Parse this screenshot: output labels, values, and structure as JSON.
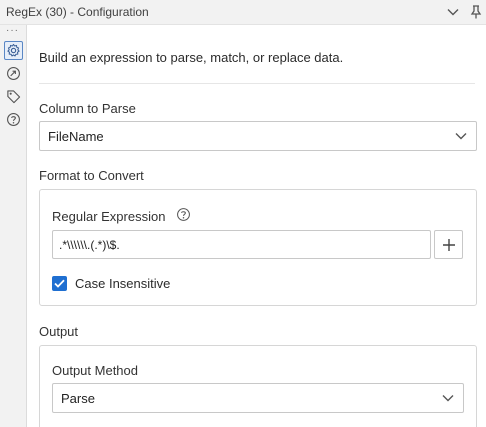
{
  "window": {
    "title": "RegEx (30) - Configuration"
  },
  "rail": {
    "items": [
      {
        "icon": "gear-icon",
        "active": true
      },
      {
        "icon": "connection-icon",
        "active": false
      },
      {
        "icon": "tag-icon",
        "active": false
      },
      {
        "icon": "help-icon",
        "active": false
      }
    ]
  },
  "main": {
    "description": "Build an expression to parse, match, or replace data.",
    "column_to_parse": {
      "label": "Column to Parse",
      "selected": "FileName"
    },
    "format_to_convert": {
      "label": "Format to Convert",
      "regex_label": "Regular Expression",
      "regex_value": ".*\\\\\\\\\\\\.(.*)\\$.",
      "case_insensitive_label": "Case Insensitive",
      "case_insensitive_checked": true
    },
    "output": {
      "label": "Output",
      "method_label": "Output Method",
      "method_selected": "Parse"
    }
  },
  "colors": {
    "accent": "#1f6fd1",
    "titlebar_bg": "#f2f2f2",
    "border": "#c8c8c8"
  }
}
